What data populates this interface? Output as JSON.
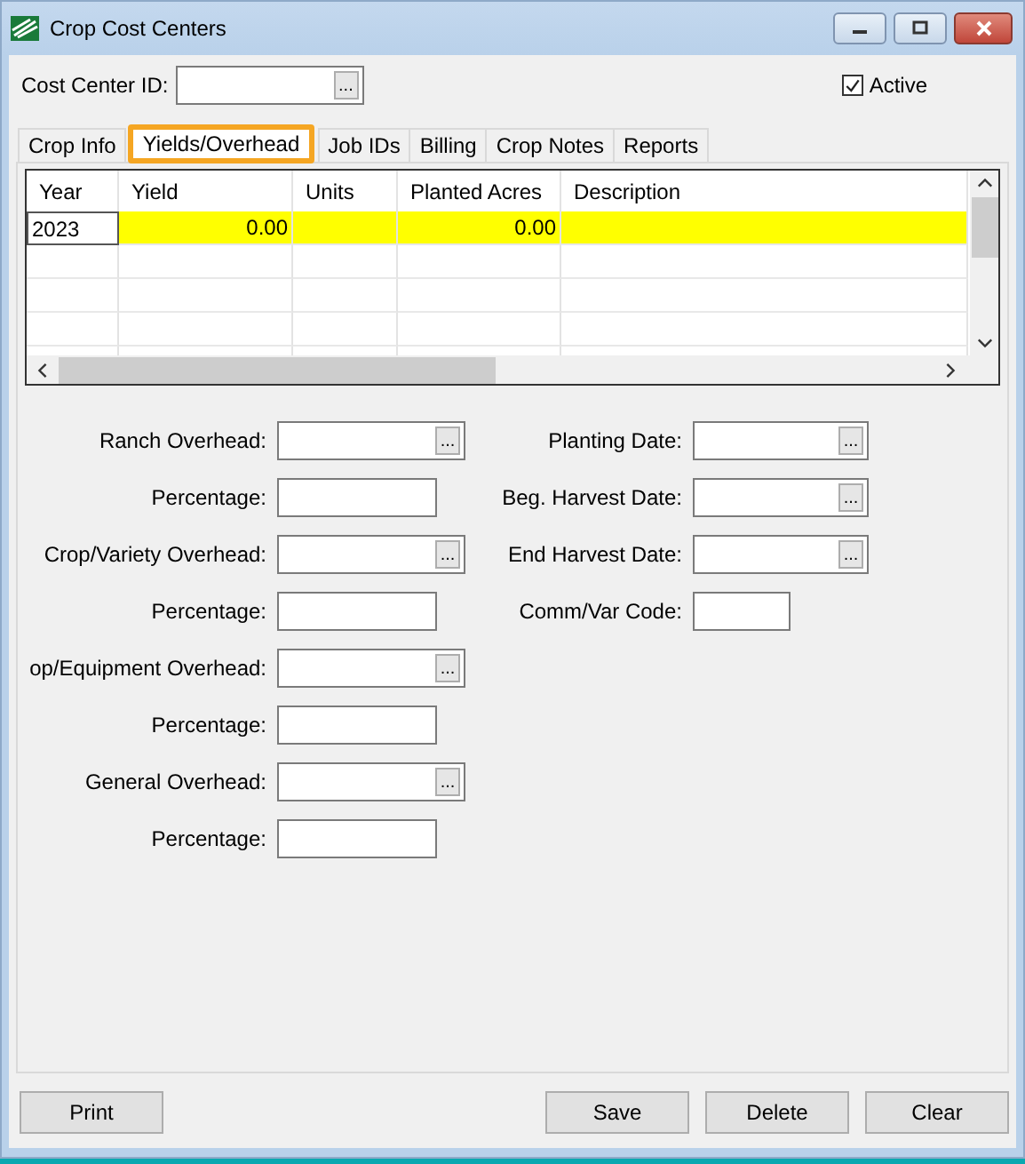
{
  "window": {
    "title": "Crop Cost Centers"
  },
  "cost_center": {
    "label": "Cost Center  ID:",
    "browse": "..."
  },
  "active": {
    "label": "Active",
    "checked": true
  },
  "tabs": [
    {
      "label": "Crop Info",
      "selected": false
    },
    {
      "label": "Yields/Overhead",
      "selected": true
    },
    {
      "label": "Job IDs",
      "selected": false
    },
    {
      "label": "Billing",
      "selected": false
    },
    {
      "label": "Crop Notes",
      "selected": false
    },
    {
      "label": "Reports",
      "selected": false
    }
  ],
  "grid": {
    "columns": [
      "Year",
      "Yield",
      "Units",
      "Planted Acres",
      "Description"
    ],
    "rows": [
      {
        "highlighted": true,
        "cells": [
          "2023",
          "0.00",
          null,
          "0.00",
          null
        ]
      }
    ]
  },
  "left_fields": [
    {
      "label": "Ranch Overhead:",
      "kind": "lookup",
      "browse": "..."
    },
    {
      "label": "Percentage:",
      "kind": "text"
    },
    {
      "label": "Crop/Variety Overhead:",
      "kind": "lookup",
      "browse": "..."
    },
    {
      "label": "Percentage:",
      "kind": "text"
    },
    {
      "label": "op/Equipment Overhead:",
      "kind": "lookup",
      "browse": "..."
    },
    {
      "label": "Percentage:",
      "kind": "text"
    },
    {
      "label": "General Overhead:",
      "kind": "lookup",
      "browse": "..."
    },
    {
      "label": "Percentage:",
      "kind": "text"
    }
  ],
  "right_fields": [
    {
      "label": "Planting Date:",
      "kind": "lookup",
      "browse": "..."
    },
    {
      "label": "Beg. Harvest Date:",
      "kind": "lookup",
      "browse": "..."
    },
    {
      "label": "End Harvest Date:",
      "kind": "lookup",
      "browse": "..."
    },
    {
      "label": "Comm/Var Code:",
      "kind": "short"
    }
  ],
  "buttons": [
    {
      "label": "Print"
    },
    {
      "label": "Save"
    },
    {
      "label": "Delete"
    },
    {
      "label": "Clear"
    }
  ]
}
